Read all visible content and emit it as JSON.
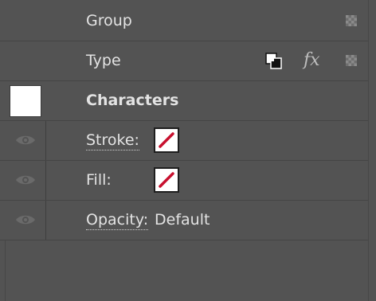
{
  "panel": {
    "rows": {
      "group": {
        "label": "Group"
      },
      "type": {
        "label": "Type"
      },
      "characters": {
        "label": "Characters"
      },
      "stroke": {
        "label": "Stroke:"
      },
      "fill": {
        "label": "Fill:"
      },
      "opacity": {
        "label": "Opacity:",
        "value": "Default"
      }
    },
    "icons": {
      "fx": "fx",
      "visibility": "eye-icon",
      "transparency": "checkerboard-icon",
      "duplicate": "duplicate-icon"
    },
    "colors": {
      "background": "#535353",
      "swatch_slash": "#c8102e"
    }
  }
}
